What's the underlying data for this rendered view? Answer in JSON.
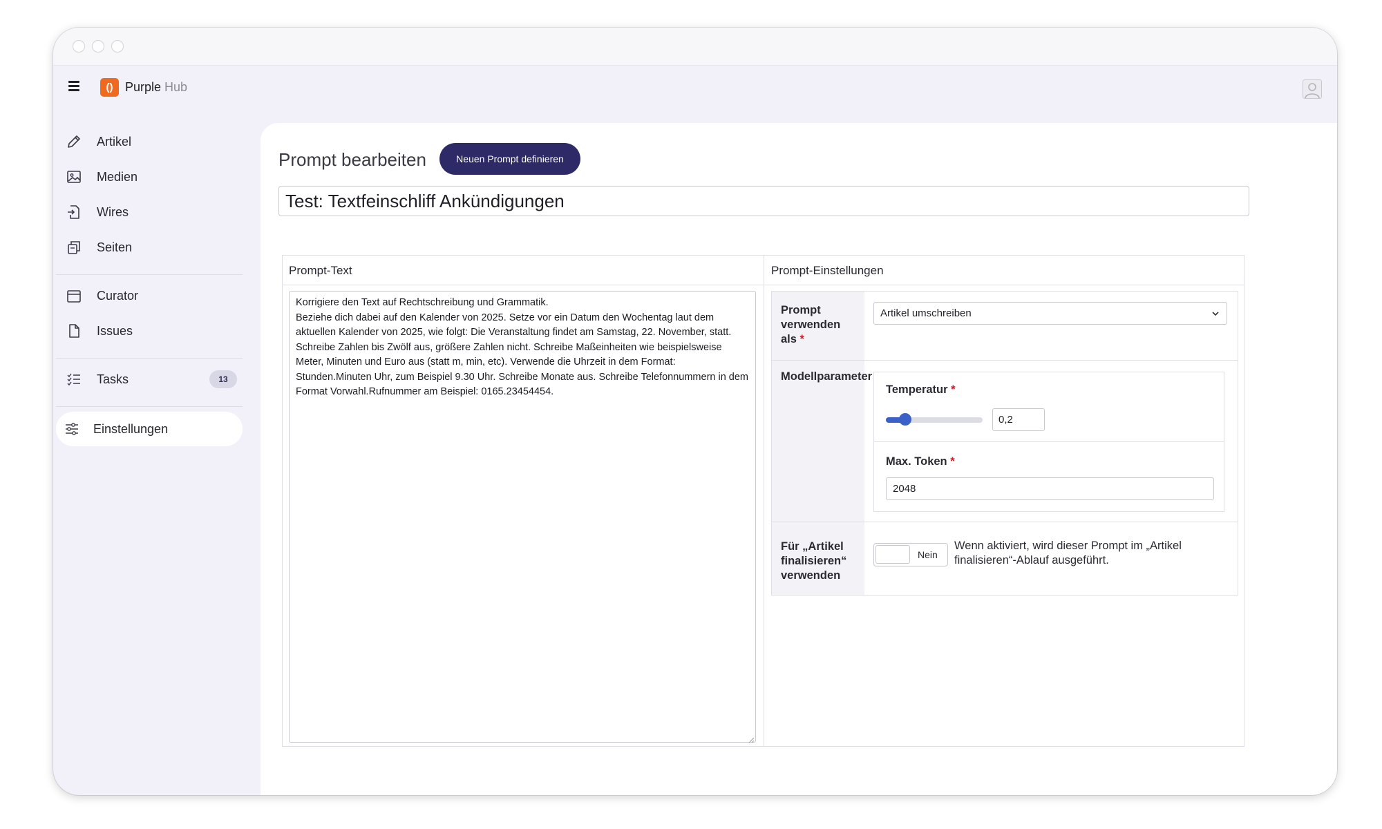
{
  "app": {
    "brand_name": "Purple",
    "brand_suffix": "Hub",
    "logo_glyph": "()"
  },
  "sidebar": {
    "items": [
      {
        "label": "Artikel",
        "icon": "pencil-icon"
      },
      {
        "label": "Medien",
        "icon": "image-icon"
      },
      {
        "label": "Wires",
        "icon": "document-in-icon"
      },
      {
        "label": "Seiten",
        "icon": "pages-icon"
      },
      {
        "label": "Curator",
        "icon": "calendar-icon"
      },
      {
        "label": "Issues",
        "icon": "file-icon"
      },
      {
        "label": "Tasks",
        "icon": "checklist-icon",
        "badge": "13"
      },
      {
        "label": "Einstellungen",
        "icon": "sliders-icon",
        "active": true
      }
    ]
  },
  "main": {
    "page_title": "Prompt bearbeiten",
    "new_prompt_button": "Neuen Prompt definieren",
    "prompt_name": "Test: Textfeinschliff Ankündigungen",
    "prompt_text_header": "Prompt-Text",
    "prompt_settings_header": "Prompt-Einstellungen",
    "prompt_text": "Korrigiere den Text auf Rechtschreibung und Grammatik.\nBeziehe dich dabei auf den Kalender von 2025. Setze vor ein Datum den Wochentag laut dem aktuellen Kalender von 2025, wie folgt: Die Veranstaltung findet am Samstag, 22. November, statt.\nSchreibe Zahlen bis Zwölf aus, größere Zahlen nicht. Schreibe Maßeinheiten wie beispielsweise Meter, Minuten und Euro aus (statt m, min, etc). Verwende die Uhrzeit in dem Format: Stunden.Minuten Uhr, zum Beispiel 9.30 Uhr. Schreibe Monate aus. Schreibe Telefonnummern in dem Format Vorwahl.Rufnummer am Beispiel: 0165.23454454."
  },
  "settings": {
    "use_as_label_1": "Prompt",
    "use_as_label_2": "verwenden",
    "use_as_label_3": "als",
    "required_mark": "*",
    "use_as_value": "Artikel umschreiben",
    "model_params_label": "Modellparameter",
    "temperature_label": "Temperatur",
    "temperature_value": "0,2",
    "temperature_fraction": 0.2,
    "max_token_label": "Max. Token",
    "max_token_value": "2048",
    "finalize_label_1": "Für „Artikel",
    "finalize_label_2": "finalisieren“",
    "finalize_label_3": "verwenden",
    "toggle_label": "Nein",
    "finalize_description": "Wenn aktiviert, wird dieser Prompt im „Artikel finalisieren“-Ablauf ausgeführt."
  },
  "colors": {
    "accent": "#2e2a68",
    "logo": "#ef6a1f",
    "slider": "#3b61c9",
    "required": "#d11a2a"
  }
}
